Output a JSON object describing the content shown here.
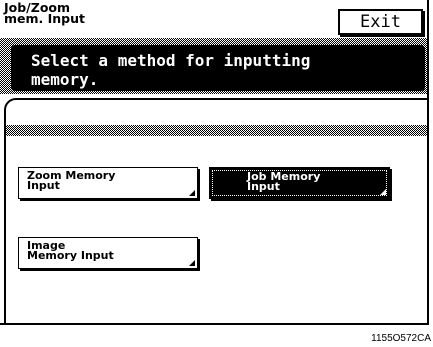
{
  "header": {
    "title": "Job/Zoom\nmem. Input",
    "exit_label": "Exit"
  },
  "message": {
    "text": "Select a method for inputting\nmemory."
  },
  "options": [
    {
      "label": "Zoom Memory\nInput",
      "selected": false
    },
    {
      "label": "Job Memory\nInput",
      "selected": true
    },
    {
      "label": "Image\nMemory Input",
      "selected": false
    }
  ],
  "caption": "1155O572CA",
  "colors": {
    "foreground": "#000000",
    "background": "#ffffff"
  }
}
